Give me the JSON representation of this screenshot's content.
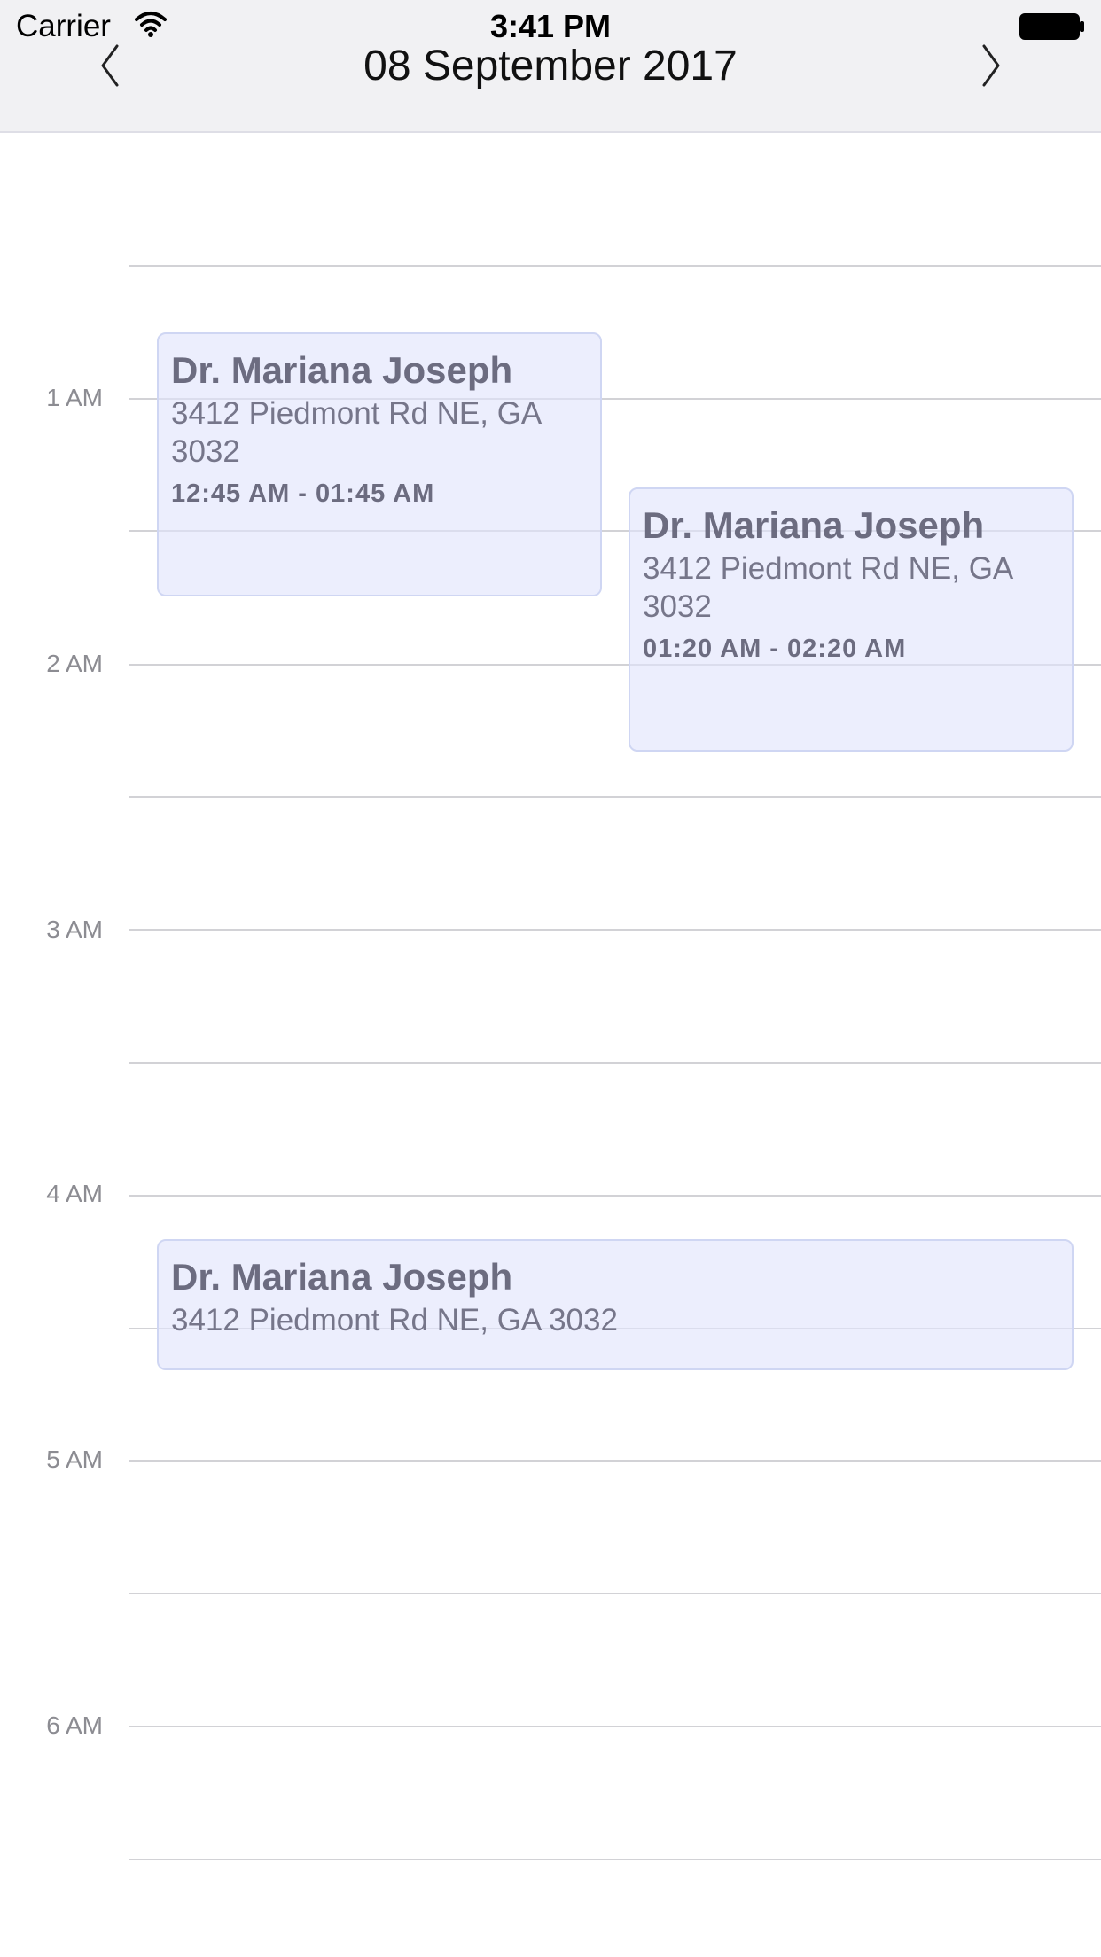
{
  "status_bar": {
    "carrier": "Carrier",
    "time": "3:41 PM",
    "wifi_icon": "wifi-icon",
    "battery_icon": "battery-icon"
  },
  "nav": {
    "title": "08 September 2017",
    "prev_icon": "chevron-left-icon",
    "next_icon": "chevron-right-icon"
  },
  "timeline": {
    "hour_labels": [
      "1 AM",
      "2 AM",
      "3 AM",
      "4 AM",
      "5 AM",
      "6 AM"
    ]
  },
  "events": [
    {
      "title": "Dr. Mariana Joseph",
      "address": "3412 Piedmont Rd NE, GA 3032",
      "time": "12:45 AM - 01:45 AM"
    },
    {
      "title": "Dr. Mariana Joseph",
      "address": "3412 Piedmont Rd NE, GA 3032",
      "time": "01:20 AM - 02:20 AM"
    },
    {
      "title": "Dr. Mariana Joseph",
      "address": "3412 Piedmont Rd NE, GA 3032",
      "time": ""
    }
  ],
  "colors": {
    "header_bg": "#f1f1f3",
    "event_bg": "#e8ebfc",
    "event_border": "#cfd6f3",
    "grid_line": "#d2d2d6"
  }
}
